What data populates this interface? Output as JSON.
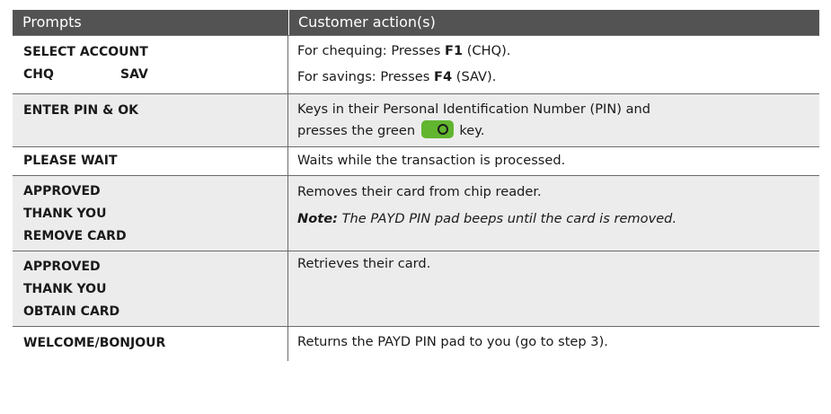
{
  "header": {
    "prompts": "Prompts",
    "actions": "Customer action(s)"
  },
  "rows": [
    {
      "prompt": {
        "line1": "SELECT ACCOUNT",
        "col_a": "CHQ",
        "col_b": "SAV"
      },
      "action": {
        "line1_pre": "For chequing: Presses ",
        "line1_key": "F1",
        "line1_post": " (CHQ).",
        "line2_pre": "For savings: Presses ",
        "line2_key": "F4",
        "line2_post": " (SAV)."
      }
    },
    {
      "prompt": {
        "line1": "ENTER PIN & OK"
      },
      "action": {
        "line1": "Keys in their Personal Identification Number (PIN) and",
        "line2_pre": "presses the green",
        "line2_post": "key."
      }
    },
    {
      "prompt": {
        "line1": "PLEASE WAIT"
      },
      "action": {
        "line1": "Waits while the transaction is processed."
      }
    },
    {
      "prompt": {
        "line1": "APPROVED",
        "line2": "THANK YOU",
        "line3": "REMOVE CARD"
      },
      "action": {
        "line1": "Removes their card from chip reader.",
        "note_label": "Note:",
        "note_text": " The PAYD PIN pad beeps until the card is removed."
      }
    },
    {
      "prompt": {
        "line1": "APPROVED",
        "line2": "THANK YOU",
        "line3": "OBTAIN CARD"
      },
      "action": {
        "line1": "Retrieves their card."
      }
    },
    {
      "prompt": {
        "line1": "WELCOME/BONJOUR"
      },
      "action": {
        "line1": "Returns the PAYD PIN pad to you (go to step 3)."
      }
    }
  ],
  "colors": {
    "header_bg": "#535353",
    "shaded_bg": "#ececec",
    "ok_key": "#61b52f"
  },
  "icons": {
    "ok_key": "green-ok-key-icon"
  }
}
